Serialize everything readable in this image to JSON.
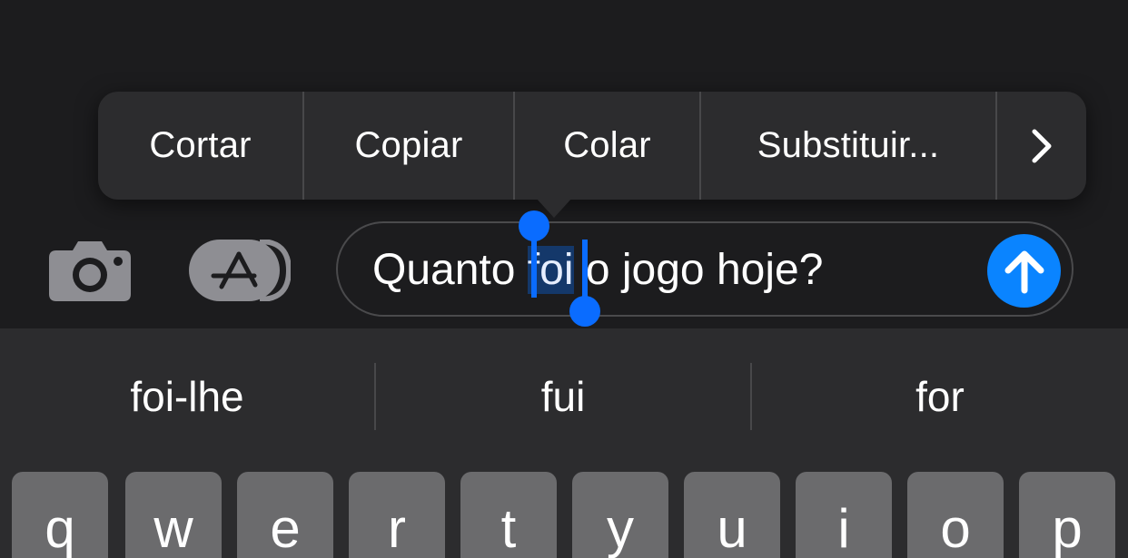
{
  "context_menu": {
    "items": [
      {
        "label": "Cortar"
      },
      {
        "label": "Copiar"
      },
      {
        "label": "Colar"
      },
      {
        "label": "Substituir..."
      }
    ],
    "more_icon": "chevron-right-icon"
  },
  "toolbar": {
    "camera_icon": "camera-icon",
    "apps_icon": "app-store-icon"
  },
  "message_input": {
    "text_before": "Quanto ",
    "selected_word": "foi",
    "text_after": " o jogo hoje?",
    "send_icon": "arrow-up-icon"
  },
  "keyboard": {
    "suggestions": [
      "foi-lhe",
      "fui",
      "for"
    ],
    "keys_row1": [
      "q",
      "w",
      "e",
      "r",
      "t",
      "y",
      "u",
      "i",
      "o",
      "p"
    ]
  },
  "colors": {
    "background": "#1c1c1e",
    "menu_bg": "#2c2c2e",
    "accent": "#0a84ff",
    "key_bg": "#6b6b6d"
  }
}
